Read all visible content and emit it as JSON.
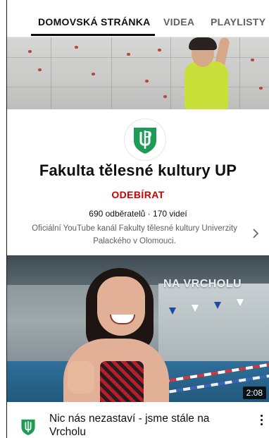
{
  "tabs": [
    {
      "label": "DOMOVSKÁ STRÁNKA",
      "active": true
    },
    {
      "label": "VIDEA",
      "active": false
    },
    {
      "label": "PLAYLISTY",
      "active": false
    }
  ],
  "channel": {
    "name": "Fakulta tělesné kultury UP",
    "subscribe_label": "ODEBÍRAT",
    "stats": "690 odběratelů · 170 videí",
    "description": "Oficiální YouTube kanál Fakulty tělesné kultury Univerzity Palackého v Olomouci.",
    "logo_icon": "up-university-shield-icon"
  },
  "video": {
    "thumbnail_text": "NA VRCHOLU",
    "duration": "2:08",
    "title": "Nic nás nezastaví - jsme stále na Vrcholu"
  },
  "colors": {
    "accent_red": "#cc0000",
    "logo_green": "#1f9b57",
    "text_primary": "#0f0f0f",
    "text_secondary": "#606060"
  }
}
